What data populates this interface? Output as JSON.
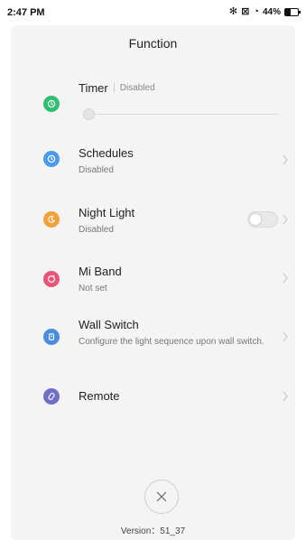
{
  "status_bar": {
    "time": "2:47 PM",
    "battery_text": "44%",
    "battery_level": 0.44
  },
  "header": {
    "title": "Function"
  },
  "timer": {
    "title": "Timer",
    "status": "Disabled",
    "icon_color": "#2fbf71",
    "icon": "timer-icon"
  },
  "items": [
    {
      "title": "Schedules",
      "subtitle": "Disabled",
      "icon_color": "#4a9bea",
      "icon": "clock-icon"
    },
    {
      "title": "Night Light",
      "subtitle": "Disabled",
      "icon_color": "#f2a23a",
      "icon": "moon-icon",
      "toggle_on": false
    },
    {
      "title": "Mi Band",
      "subtitle": "Not set",
      "icon_color": "#e9547a",
      "icon": "band-icon"
    },
    {
      "title": "Wall Switch",
      "subtitle": "Configure the light sequence upon wall switch.",
      "icon_color": "#4a8ddf",
      "icon": "switch-icon"
    },
    {
      "title": "Remote",
      "subtitle": "",
      "icon_color": "#6f6fc4",
      "icon": "remote-icon"
    }
  ],
  "footer": {
    "version": "Version：51_37"
  }
}
